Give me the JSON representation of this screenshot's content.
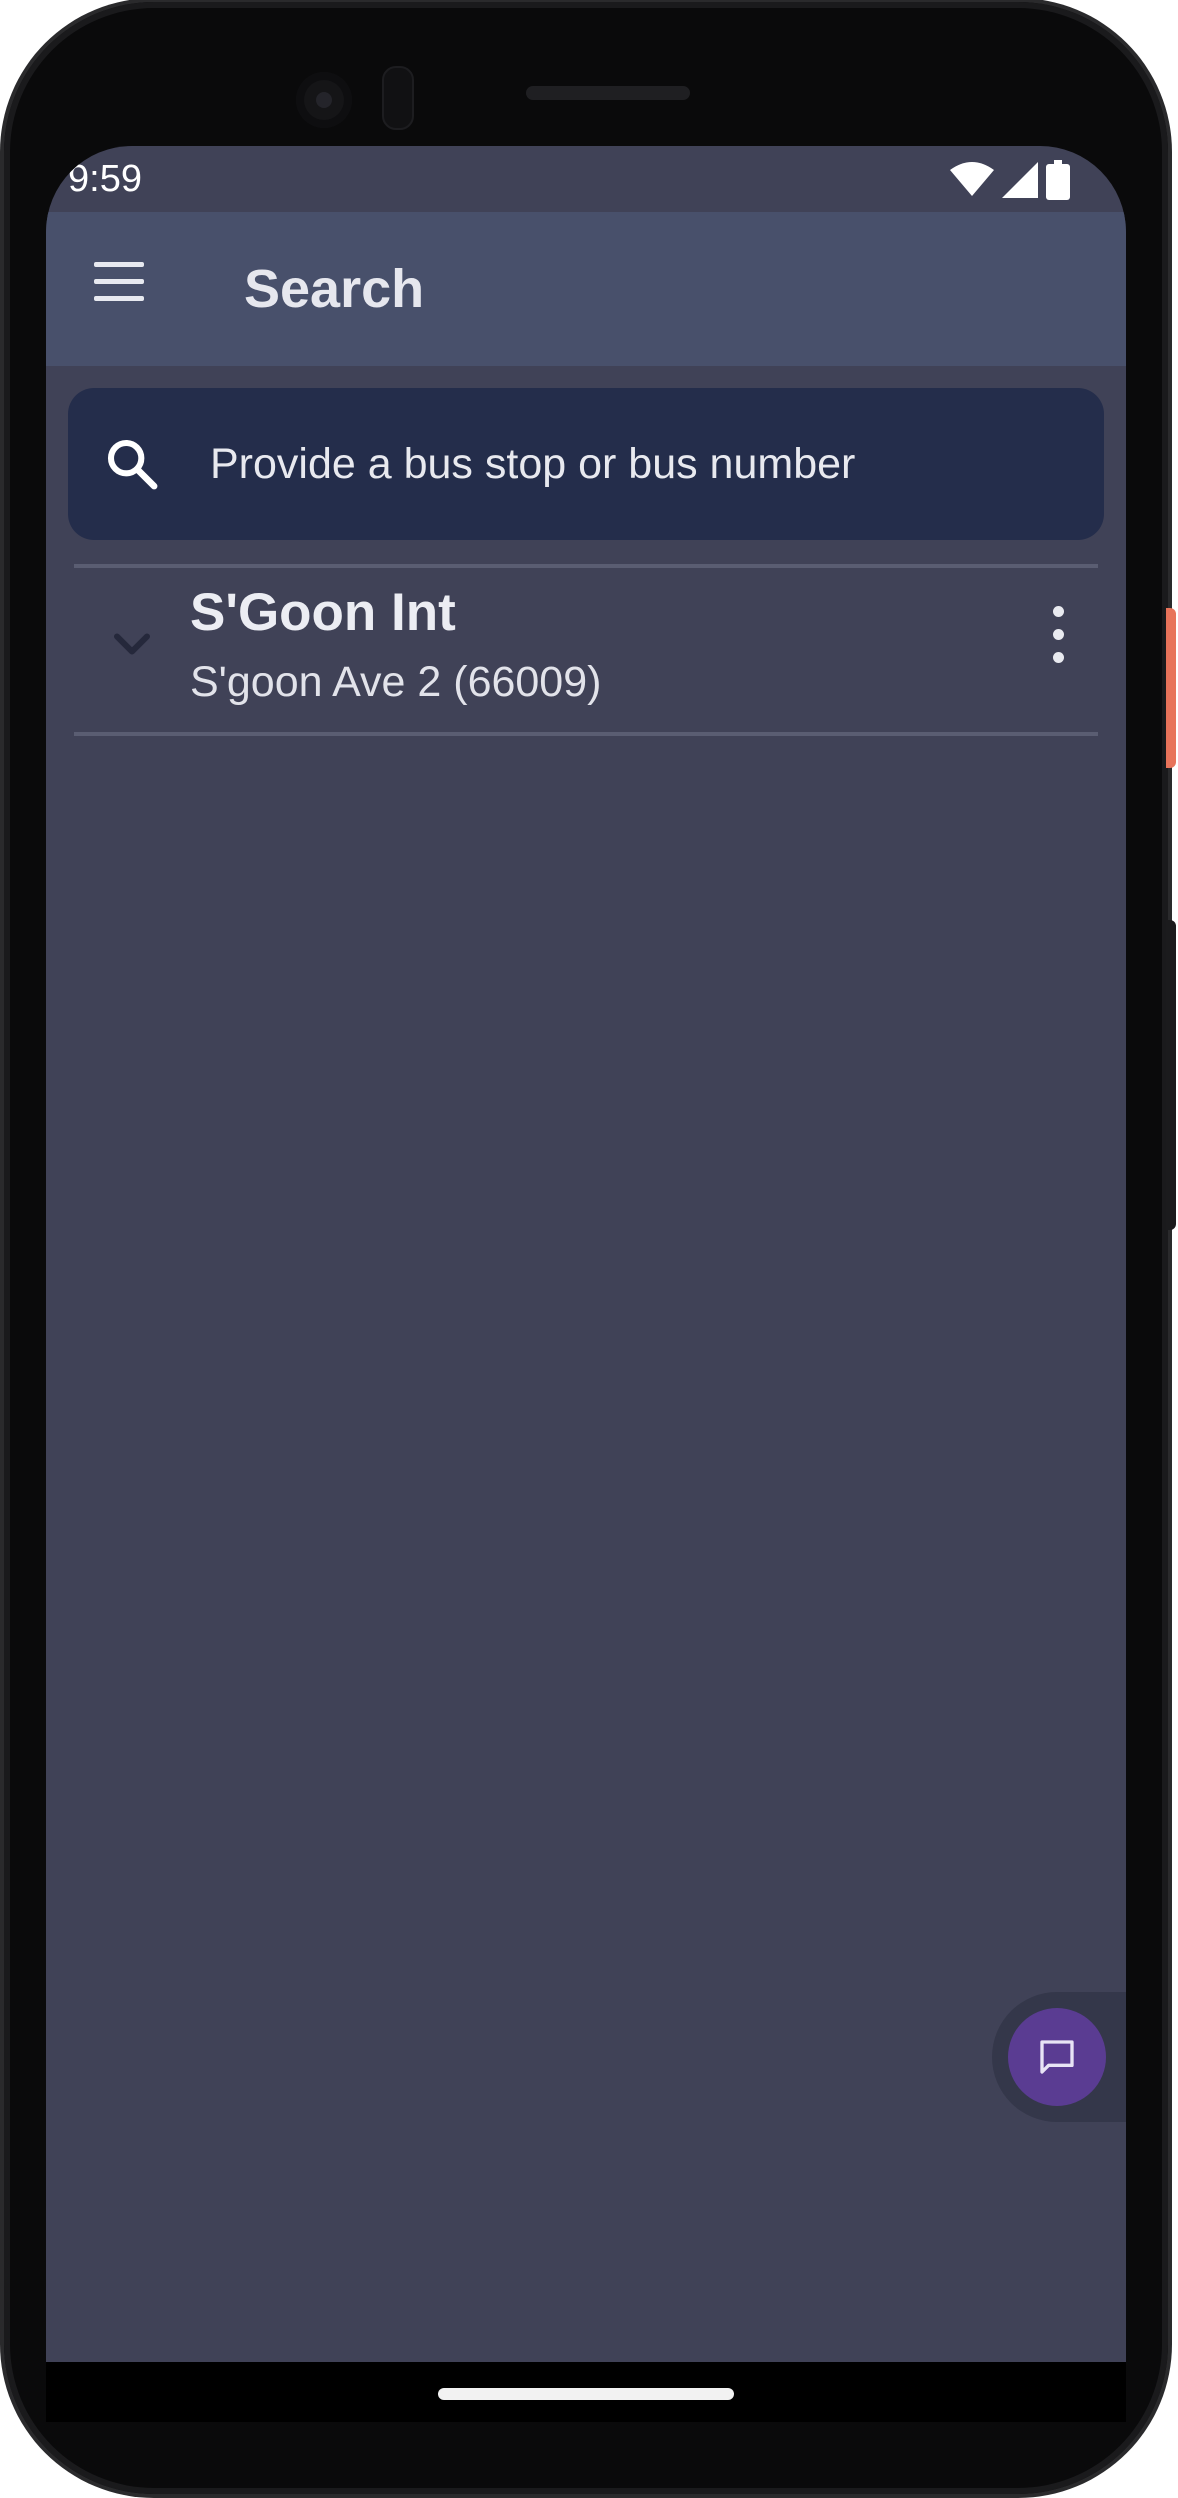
{
  "status_bar": {
    "time": "9:59"
  },
  "app_bar": {
    "title": "Search"
  },
  "search": {
    "placeholder": "Provide a bus stop or bus number"
  },
  "results": [
    {
      "title": "S'Goon Int",
      "subtitle": "S'goon Ave 2 (66009)"
    }
  ],
  "colors": {
    "screen_background": "#404257",
    "app_bar": "#48506b",
    "search_box": "#242d4b",
    "fab": "#5a3c92"
  },
  "icons": [
    "menu-icon",
    "search-icon",
    "chevron-down-icon",
    "more-vert-icon",
    "chat-icon",
    "wifi-icon",
    "signal-icon",
    "battery-icon"
  ]
}
